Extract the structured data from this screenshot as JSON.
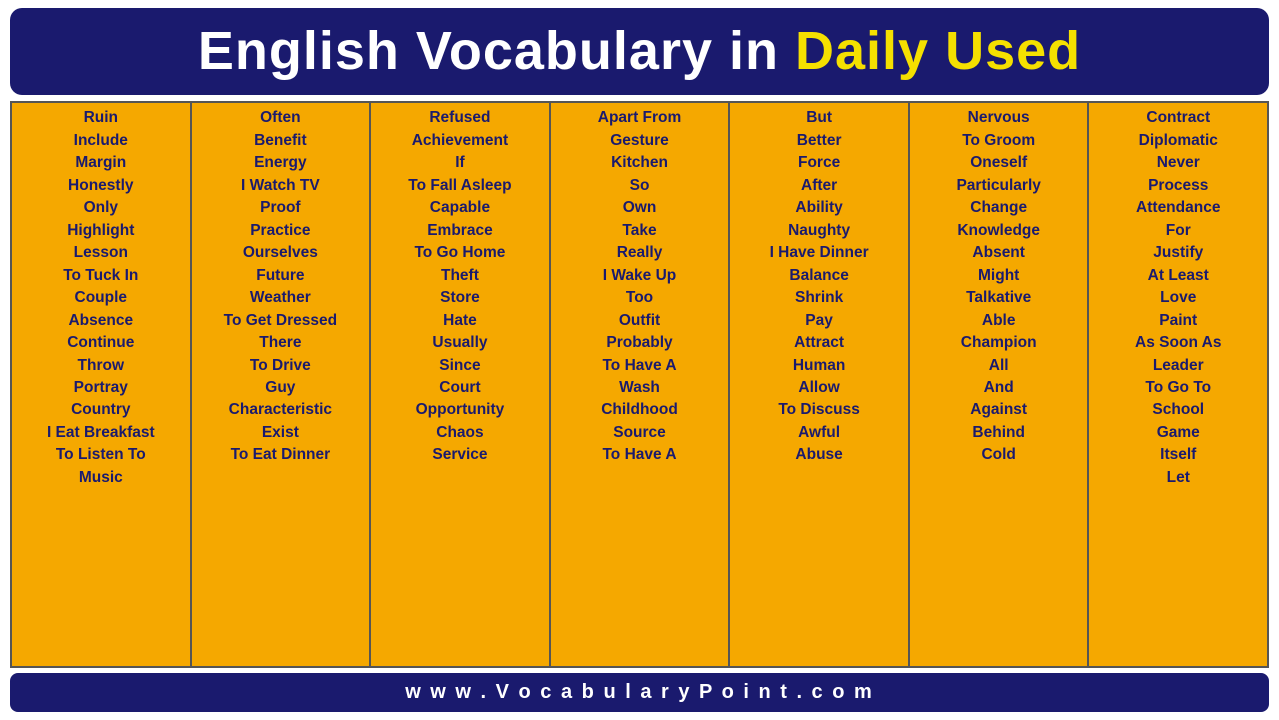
{
  "header": {
    "title_white": "English Vocabulary in",
    "title_yellow": "Daily Used"
  },
  "columns": [
    {
      "words": [
        "Ruin",
        "Include",
        "Margin",
        "Honestly",
        "Only",
        "Highlight",
        "Lesson",
        "To Tuck In",
        "Couple",
        "Absence",
        "Continue",
        "Throw",
        "Portray",
        "Country",
        "I Eat Breakfast",
        "To Listen To",
        "Music"
      ]
    },
    {
      "words": [
        "Often",
        "Benefit",
        "Energy",
        "I Watch TV",
        "Proof",
        "Practice",
        "Ourselves",
        "Future",
        "Weather",
        "To Get Dressed",
        "There",
        "To Drive",
        "Guy",
        "Characteristic",
        "Exist",
        "To Eat Dinner"
      ]
    },
    {
      "words": [
        "Refused",
        "Achievement",
        "If",
        "To Fall Asleep",
        "Capable",
        "Embrace",
        "To Go Home",
        "Theft",
        "Store",
        "Hate",
        "Usually",
        "Since",
        "Court",
        "Opportunity",
        "Chaos",
        "Service"
      ]
    },
    {
      "words": [
        "Apart From",
        "Gesture",
        "Kitchen",
        "So",
        "Own",
        "Take",
        "Really",
        "I Wake Up",
        "Too",
        "Outfit",
        "Probably",
        "To Have A",
        "Wash",
        "Childhood",
        "Source",
        "To Have A"
      ]
    },
    {
      "words": [
        "But",
        "Better",
        "Force",
        "After",
        "Ability",
        "Naughty",
        "I Have Dinner",
        "Balance",
        "Shrink",
        "Pay",
        "Attract",
        "Human",
        "Allow",
        "To Discuss",
        "Awful",
        "Abuse"
      ]
    },
    {
      "words": [
        "Nervous",
        "To Groom",
        "Oneself",
        "Particularly",
        "Change",
        "Knowledge",
        "Absent",
        "Might",
        "Talkative",
        "Able",
        "Champion",
        "All",
        "And",
        "Against",
        "Behind",
        "Cold"
      ]
    },
    {
      "words": [
        "Contract",
        "Diplomatic",
        "Never",
        "Process",
        "Attendance",
        "For",
        "Justify",
        "At Least",
        "Love",
        "Paint",
        "As Soon As",
        "Leader",
        "To Go To",
        "School",
        "Game",
        "Itself",
        "Let"
      ]
    }
  ],
  "footer": {
    "url": "w w w . V o c a b u l a r y P o i n t . c o m"
  }
}
